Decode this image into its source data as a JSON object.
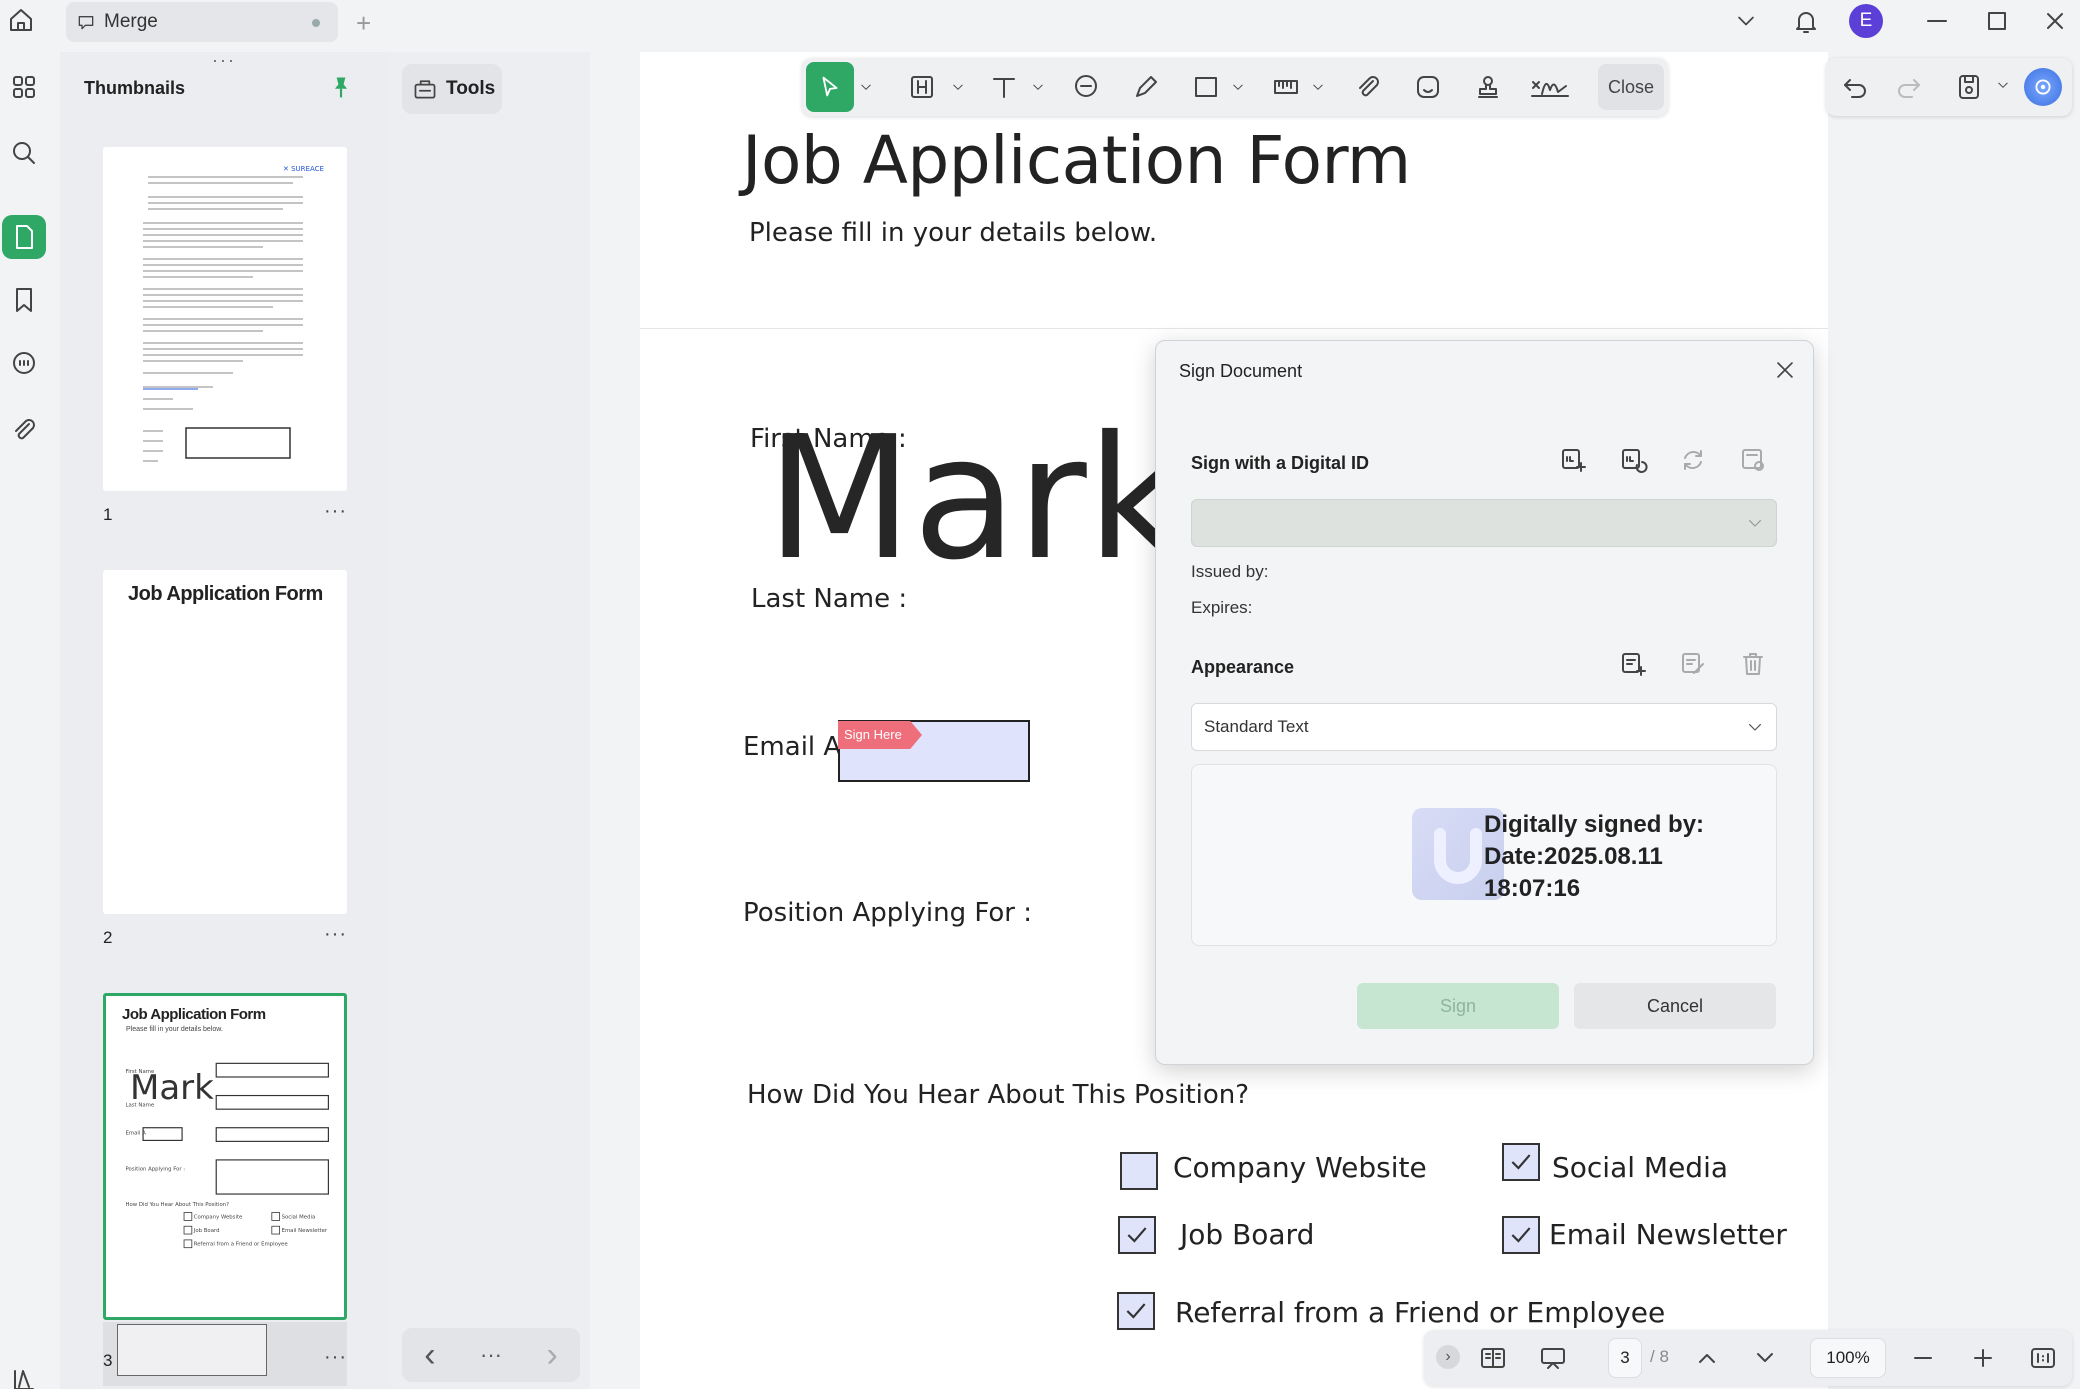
{
  "app": {
    "tab_title": "Merge",
    "user_initial": "E"
  },
  "thumbnails": {
    "title": "Thumbnails",
    "pages": [
      {
        "number": "1",
        "more": "···"
      },
      {
        "number": "2",
        "more": "···",
        "heading": "Job Application Form"
      },
      {
        "number": "3",
        "more": "···",
        "heading": "Job Application Form",
        "sub": "Please fill in your details below.",
        "name": "Mark"
      }
    ]
  },
  "tools_panel": {
    "tools_label": "Tools",
    "prev": "‹",
    "more": "···",
    "next": "›"
  },
  "toolbar": {
    "close_label": "Close"
  },
  "document": {
    "title": "Job Application Form",
    "subtitle": "Please fill in your details below.",
    "first_name_label": "First Name :",
    "first_name_value": "Mark",
    "last_name_label": "Last Name :",
    "email_label": "Email A",
    "sign_here": "Sign Here",
    "position_label": "Position Applying For :",
    "how_heard_label": "How Did You Hear About This Position?",
    "options": [
      {
        "label": "Company Website",
        "checked": false
      },
      {
        "label": "Social Media",
        "checked": true
      },
      {
        "label": "Job Board",
        "checked": true
      },
      {
        "label": "Email Newsletter",
        "checked": true
      },
      {
        "label": "Referral from a Friend or Employee",
        "checked": true
      }
    ]
  },
  "dialog": {
    "title": "Sign Document",
    "digital_id_heading": "Sign with a Digital ID",
    "issued_by_label": "Issued by:",
    "expires_label": "Expires:",
    "appearance_heading": "Appearance",
    "appearance_value": "Standard Text",
    "preview_line1": "Digitally signed by:",
    "preview_line2": "Date:2025.08.11",
    "preview_line3": "18:07:16",
    "sign_button": "Sign",
    "cancel_button": "Cancel"
  },
  "bottombar": {
    "current_page": "3",
    "total_pages": "/ 8",
    "zoom": "100%"
  }
}
